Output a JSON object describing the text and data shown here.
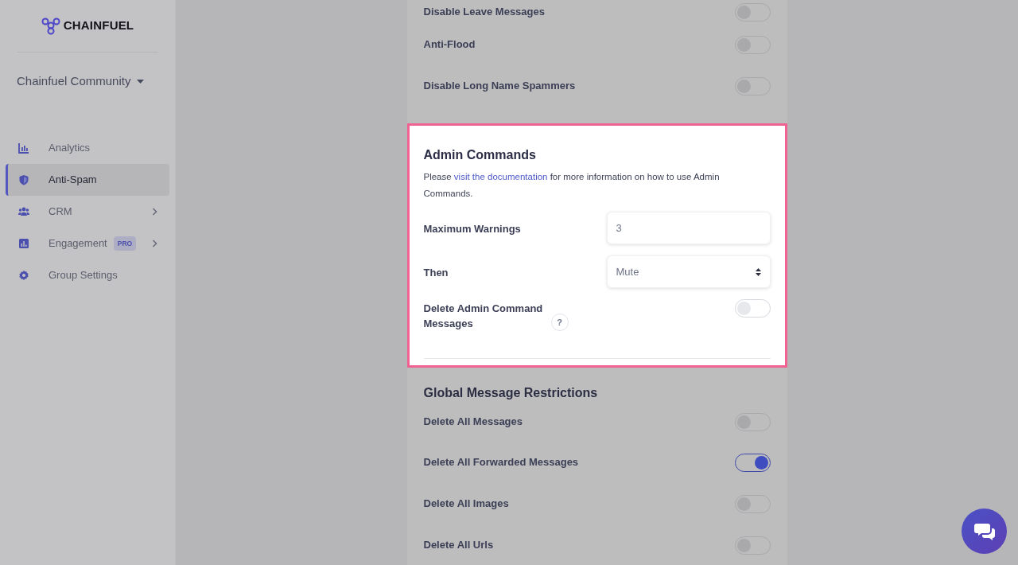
{
  "sidebar": {
    "logo": "CHAINFUEL",
    "group": "Chainfuel Community",
    "items": [
      {
        "label": "Analytics",
        "selected": false,
        "expandable": false
      },
      {
        "label": "Anti-Spam",
        "selected": true,
        "expandable": false
      },
      {
        "label": "CRM",
        "selected": false,
        "expandable": true
      },
      {
        "label": "Engagement",
        "selected": false,
        "expandable": true,
        "badge": "PRO"
      },
      {
        "label": "Group Settings",
        "selected": false,
        "expandable": false
      }
    ]
  },
  "top_toggles": [
    {
      "label": "Disable Leave Messages",
      "on": false
    },
    {
      "label": "Anti-Flood",
      "on": false
    },
    {
      "label": "Disable Long Name Spammers",
      "on": false
    }
  ],
  "admin_commands": {
    "title": "Admin Commands",
    "text_before": "Please ",
    "link": "visit the documentation",
    "text_after": " for more information on how to use Admin Commands.",
    "maximum_warnings": {
      "label": "Maximum Warnings",
      "value": "3"
    },
    "then": {
      "label": "Then",
      "value": "Mute"
    },
    "delete_messages": {
      "label": "Delete Admin Command Messages",
      "help": "?",
      "on": false
    }
  },
  "global_restrictions": {
    "title": "Global Message Restrictions",
    "toggles": [
      {
        "label": "Delete All Messages",
        "on": false
      },
      {
        "label": "Delete All Forwarded Messages",
        "on": true
      },
      {
        "label": "Delete All Images",
        "on": false
      },
      {
        "label": "Delete All Urls",
        "on": false
      }
    ]
  }
}
